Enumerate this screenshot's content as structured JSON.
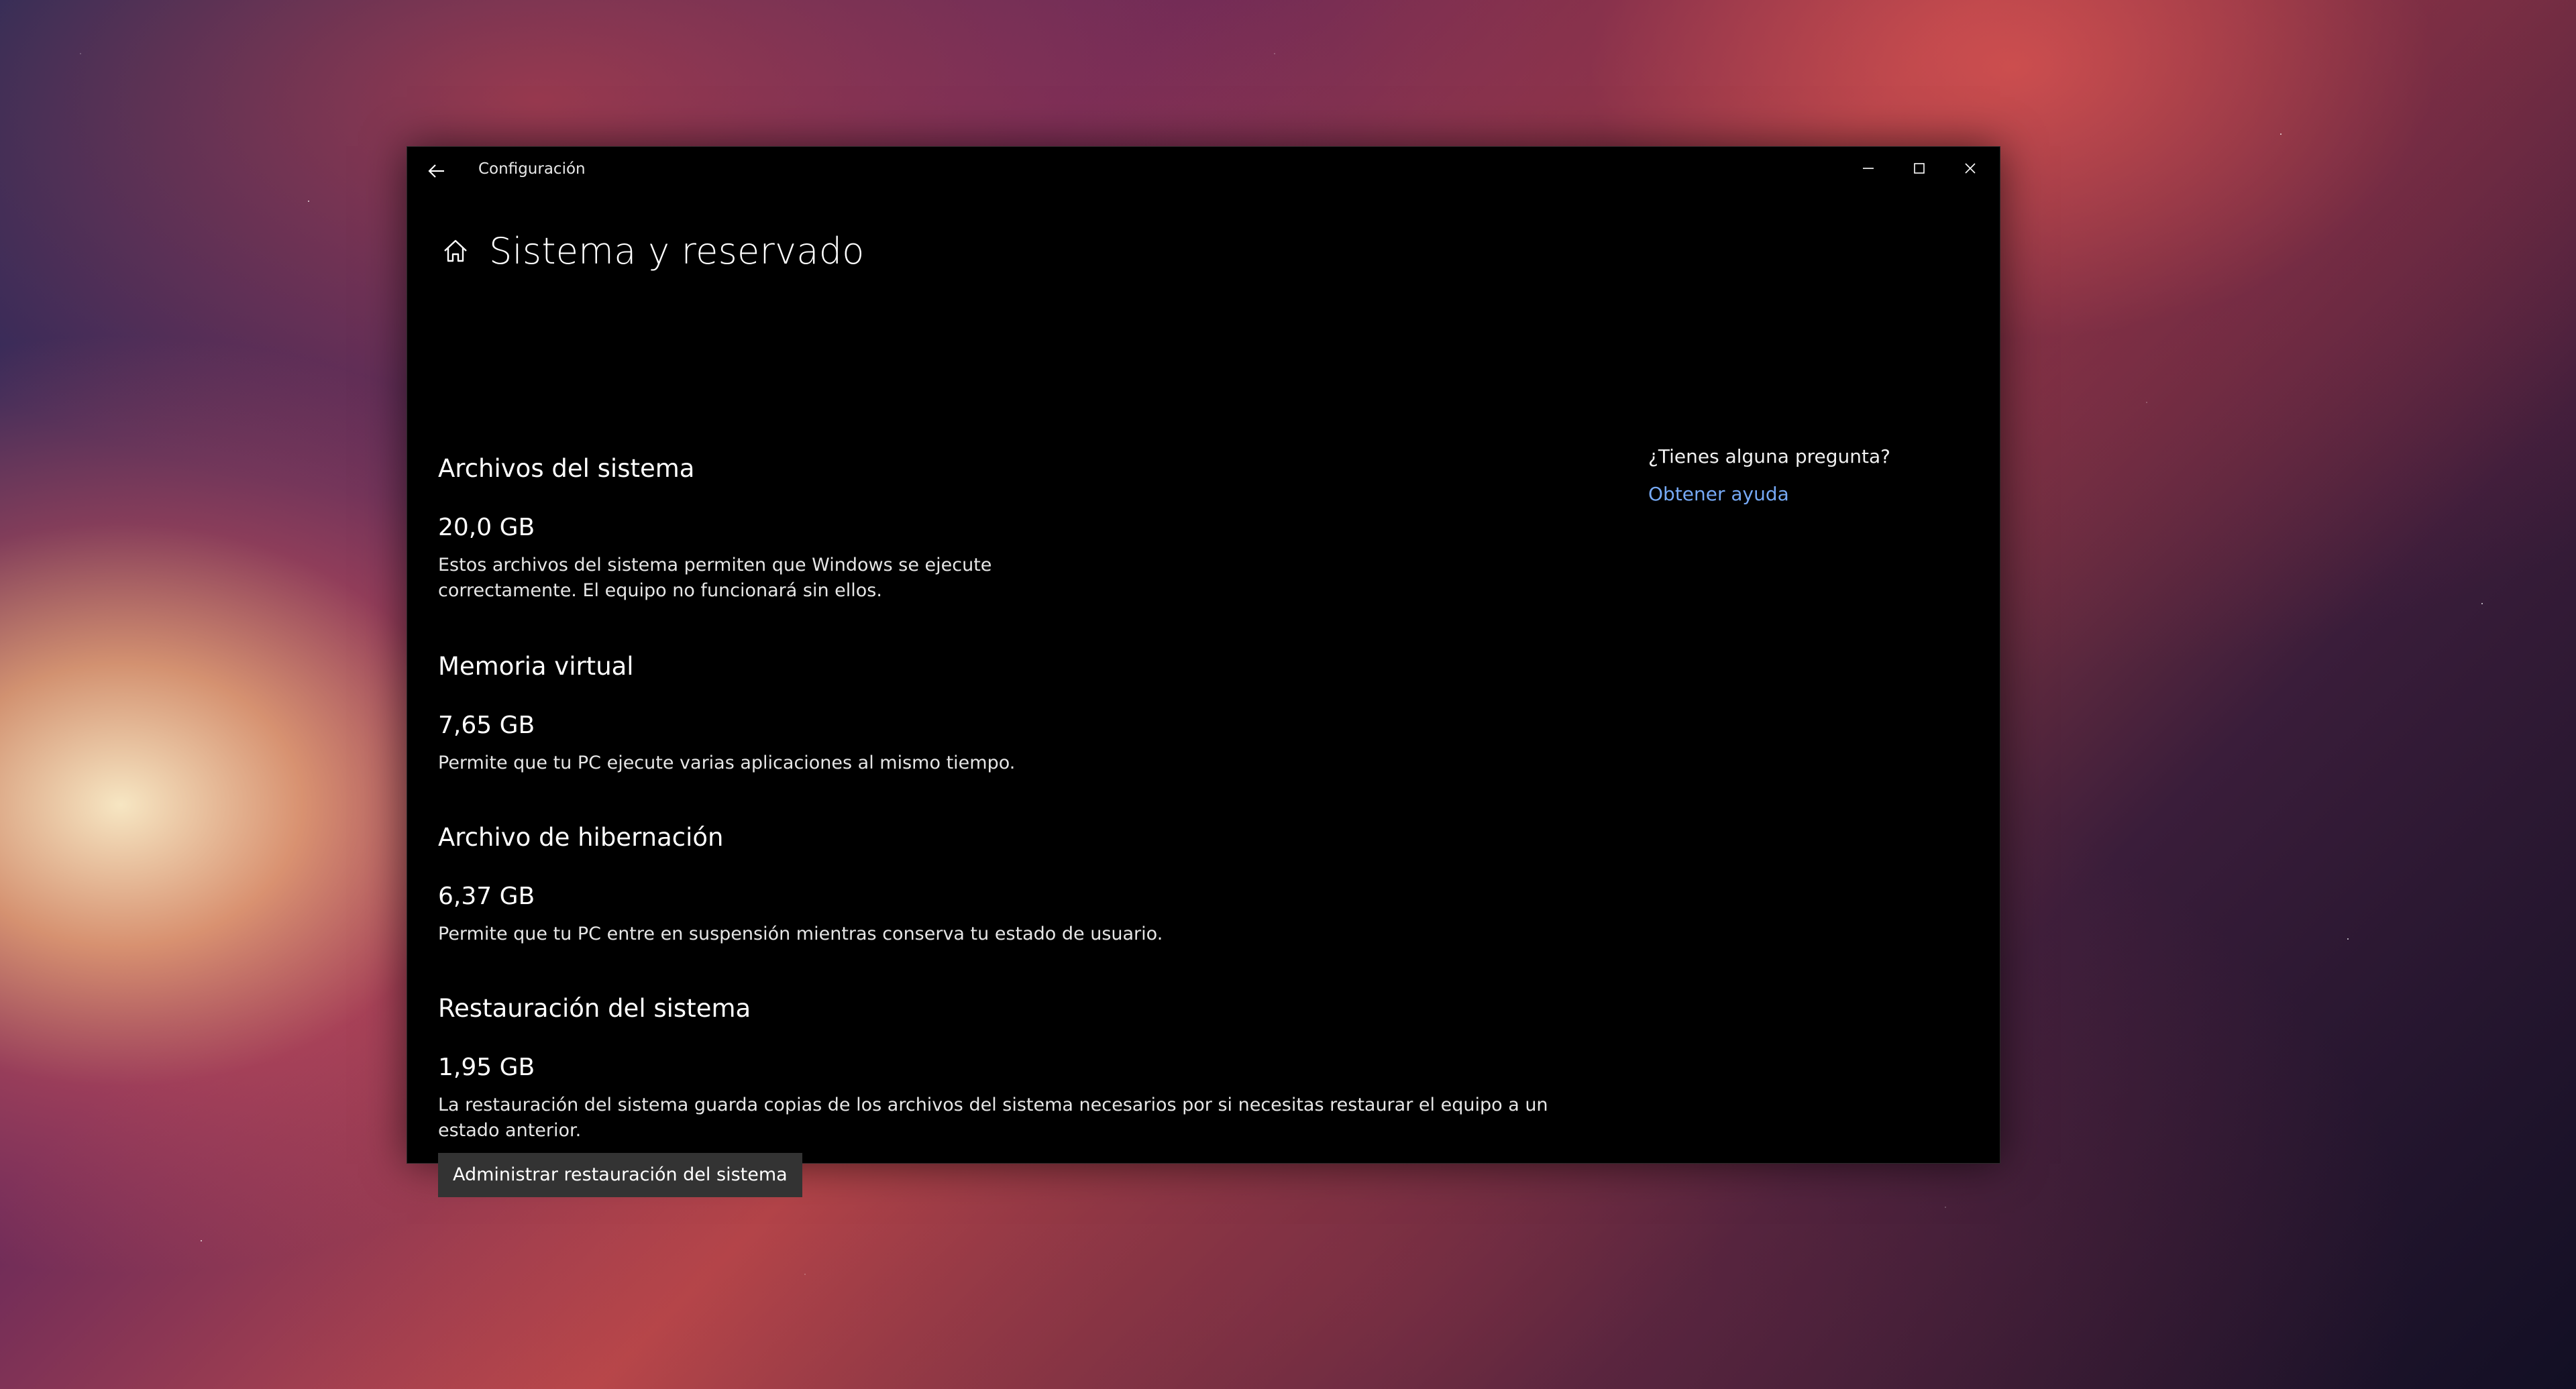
{
  "window": {
    "title": "Configuración",
    "controls": {
      "back_icon": "arrow-left-icon",
      "minimize_icon": "minimize-icon",
      "maximize_icon": "maximize-icon",
      "close_icon": "close-icon"
    }
  },
  "header": {
    "icon": "home-icon",
    "title": "Sistema y reservado"
  },
  "sections": [
    {
      "title": "Archivos del sistema",
      "size": "20,0 GB",
      "description": "Estos archivos del sistema permiten que Windows se ejecute correctamente. El equipo no funcionará sin ellos."
    },
    {
      "title": "Memoria virtual",
      "size": "7,65 GB",
      "description": "Permite que tu PC ejecute varias aplicaciones al mismo tiempo."
    },
    {
      "title": "Archivo de hibernación",
      "size": "6,37 GB",
      "description": "Permite que tu PC entre en suspensión mientras conserva tu estado de usuario."
    },
    {
      "title": "Restauración del sistema",
      "size": "1,95 GB",
      "description": "La restauración del sistema guarda copias de los archivos del sistema necesarios por si necesitas restaurar el equipo a un estado anterior.",
      "button_label": "Administrar restauración del sistema"
    }
  ],
  "help": {
    "question": "¿Tienes alguna pregunta?",
    "link": "Obtener ayuda"
  },
  "colors": {
    "window_bg": "#000000",
    "link": "#76a9f5",
    "button_bg": "#333333"
  }
}
